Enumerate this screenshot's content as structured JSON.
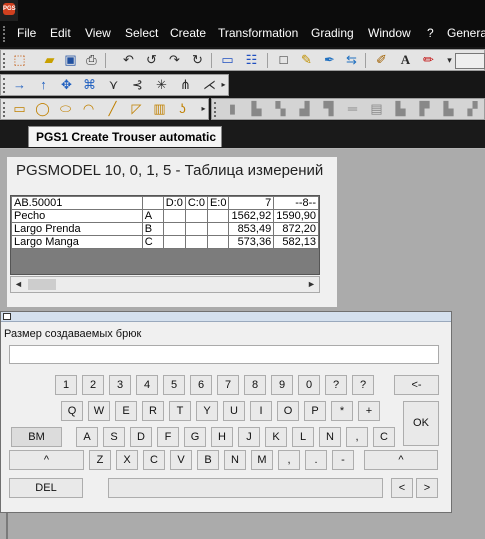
{
  "app": {
    "logo_text": "PGS"
  },
  "menu": [
    "File",
    "Edit",
    "View",
    "Select",
    "Create",
    "Transformation",
    "Grading",
    "Window",
    "?",
    "Genera"
  ],
  "tab": {
    "label": "PGS1 Create Trouser automatic"
  },
  "measurement": {
    "title": "PGSMODEL  10, 0, 1, 5 - Таблица измерений",
    "headers": [
      "AB.50001",
      "",
      "D:0",
      "C:0",
      "E:0",
      "7",
      "--8--"
    ],
    "rows": [
      [
        "Pecho",
        "A",
        "",
        "",
        "",
        "1562,92",
        "1590,90"
      ],
      [
        "Largo Prenda",
        "B",
        "",
        "",
        "",
        "853,49",
        "872,20"
      ],
      [
        "Largo Manga",
        "C",
        "",
        "",
        "",
        "573,36",
        "582,13"
      ]
    ],
    "scroll_left": "◄",
    "scroll_right": "►"
  },
  "keyboard": {
    "prompt": "Размер создаваемых брюк",
    "input_value": "",
    "row1": [
      "1",
      "2",
      "3",
      "4",
      "5",
      "6",
      "7",
      "8",
      "9",
      "0",
      "?",
      "?"
    ],
    "backspace": "<-",
    "row2": [
      "Q",
      "W",
      "E",
      "R",
      "T",
      "Y",
      "U",
      "I",
      "O",
      "P",
      "*",
      "+"
    ],
    "ok": "OK",
    "bm": "BM",
    "row3": [
      "A",
      "S",
      "D",
      "F",
      "G",
      "H",
      "J",
      "K",
      "L",
      "N",
      ",",
      "C"
    ],
    "caret_left": "^",
    "row4": [
      "Z",
      "X",
      "C",
      "V",
      "B",
      "N",
      "M",
      ",",
      ".",
      "-"
    ],
    "caret_right": "^",
    "del": "DEL",
    "space": "",
    "arrow_left": "<",
    "arrow_right": ">"
  },
  "colors": {
    "menubar_bg": "#0c0c0c",
    "toolbar_bg": "#e4e4e4",
    "panel_bg": "#f0f0f0"
  }
}
